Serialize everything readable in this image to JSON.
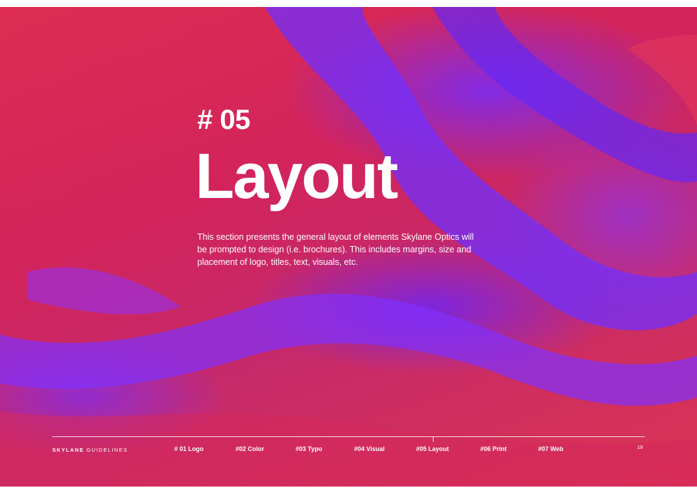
{
  "section": {
    "number": "# 05",
    "title": "Layout",
    "description": "This section presents the general layout of elements Skylane Optics will be prompted to design (i.e. brochures). This includes margins, size and placement of logo, titles, text, visuals, etc."
  },
  "footer": {
    "brand_strong": "SKYLANE",
    "brand_rest": " GUIDELINES",
    "nav": [
      {
        "label": "# 01 Logo"
      },
      {
        "label": "#02 Color"
      },
      {
        "label": "#03 Typo"
      },
      {
        "label": "#04 Visual"
      },
      {
        "label": "#05 Layout"
      },
      {
        "label": "#06 Print"
      },
      {
        "label": "#07 Web"
      }
    ],
    "page_number": "19"
  },
  "colors": {
    "background_red": "#e3283f",
    "background_violet": "#6e28ff",
    "text": "#ffffff"
  }
}
